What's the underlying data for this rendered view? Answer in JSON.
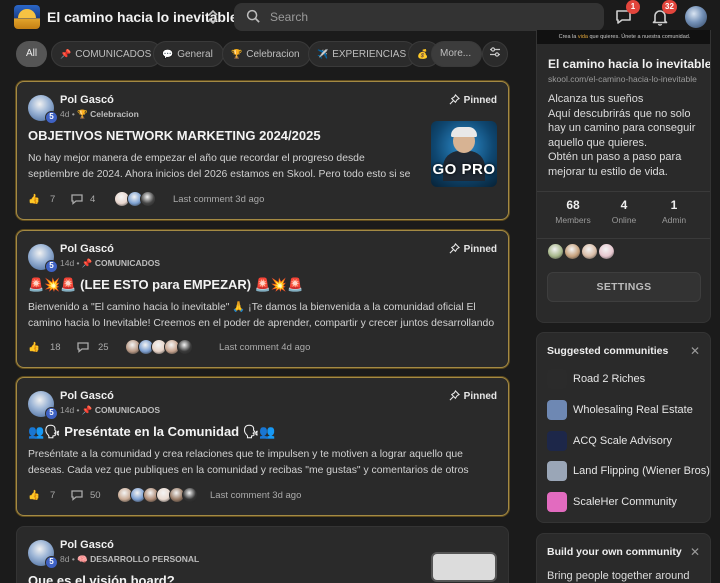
{
  "header": {
    "community_name": "El camino hacia lo inevitable",
    "search_placeholder": "Search",
    "notifications": {
      "chat_count": "1",
      "bell_count": "32"
    }
  },
  "filters": [
    {
      "label": "All",
      "icon": ""
    },
    {
      "label": "COMUNICADOS",
      "icon": "pin-icon"
    },
    {
      "label": "General",
      "icon": "speech-bubble-icon"
    },
    {
      "label": "Celebracion",
      "icon": "trophy-icon"
    },
    {
      "label": "EXPERIENCIAS",
      "icon": "airplane-icon"
    },
    {
      "label": "",
      "icon": "money-bag-icon"
    },
    {
      "label": "More...",
      "icon": ""
    }
  ],
  "posts": [
    {
      "author": "Pol Gascó",
      "level": "5",
      "age": "4d",
      "category": "Celebracion",
      "category_icon": "trophy-icon",
      "pinned_label": "Pinned",
      "title": "OBJETIVOS NETWORK MARKETING 2024/2025",
      "body": "No hay mejor manera de empezar el año que recordar el progreso desde septiembre de 2024. Ahora inicios del 2026 estamos en Skool. Pero todo esto si se da es gracias a",
      "likes": "7",
      "comments": "4",
      "last_comment": "Last comment 3d ago",
      "thumbnail_text": "GO PRO",
      "commenter_colors": [
        "#e9d7cf",
        "#7da1d1",
        "#444444"
      ]
    },
    {
      "author": "Pol Gascó",
      "level": "5",
      "age": "14d",
      "category": "COMUNICADOS",
      "category_icon": "pin-icon",
      "pinned_label": "Pinned",
      "title": "🚨💥🚨 (LEE ESTO para EMPEZAR) 🚨💥🚨",
      "body": "Bienvenido a \"El camino hacia lo inevitable\" 🙏 ¡Te damos la bienvenida a la comunidad oficial El camino hacia lo Inevitable! Creemos en el poder de aprender, compartir y crecer juntos desarrollando el",
      "likes": "18",
      "comments": "25",
      "last_comment": "Last comment 4d ago",
      "commenter_colors": [
        "#b99a86",
        "#7d9fd0",
        "#e7d3c7",
        "#c8a590",
        "#3a3a3a"
      ]
    },
    {
      "author": "Pol Gascó",
      "level": "5",
      "age": "14d",
      "category": "COMUNICADOS",
      "category_icon": "pin-icon",
      "pinned_label": "Pinned",
      "title": "👥🗣 Preséntate en la Comunidad 🗣👥",
      "body": "Preséntate a la comunidad y crea relaciones que te impulsen y te motiven a lograr aquello que deseas. Cada vez que publiques en la comunidad y recibas \"me gustas\" y comentarios de otros miembros gana",
      "likes": "7",
      "comments": "50",
      "last_comment": "Last comment 3d ago",
      "commenter_colors": [
        "#c9ab95",
        "#7d9fd0",
        "#b08d77",
        "#e8d9cf",
        "#9a7d68",
        "#333333"
      ]
    },
    {
      "author": "Pol Gascó",
      "level": "5",
      "age": "8d",
      "category": "DESARROLLO PERSONAL",
      "category_icon": "brain-icon",
      "title": "Que es el visión board?"
    }
  ],
  "sidebar": {
    "banner_prefix": "Crea la ",
    "banner_highlight": "vida",
    "banner_suffix": " que quieres. Únete a nuestra comunidad.",
    "name": "El camino hacia lo inevitable",
    "url": "skool.com/el-camino-hacia-lo-inevitable",
    "description": "Alcanza tus sueños\nAquí descubrirás que no solo hay un camino para conseguir aquello que quieres.\nObtén un paso a paso para mejorar tu estilo de vida.",
    "stats": [
      {
        "value": "68",
        "label": "Members"
      },
      {
        "value": "4",
        "label": "Online"
      },
      {
        "value": "1",
        "label": "Admin"
      }
    ],
    "settings_label": "SETTINGS",
    "member_colors": [
      "#a8b88c",
      "#c7a27e",
      "#d9bca6",
      "#e6c7cf"
    ]
  },
  "suggested": {
    "title": "Suggested communities",
    "items": [
      {
        "name": "Road 2 Riches",
        "color": "#2b2b2b"
      },
      {
        "name": "Wholesaling Real Estate",
        "color": "#6e88b3"
      },
      {
        "name": "ACQ Scale Advisory",
        "color": "#1d2749"
      },
      {
        "name": "Land Flipping (Wiener Bros)",
        "color": "#9aa6b7"
      },
      {
        "name": "ScaleHer Community",
        "color": "#e26bbf"
      }
    ]
  },
  "build": {
    "title": "Build your own community",
    "line": "Bring people together around"
  }
}
